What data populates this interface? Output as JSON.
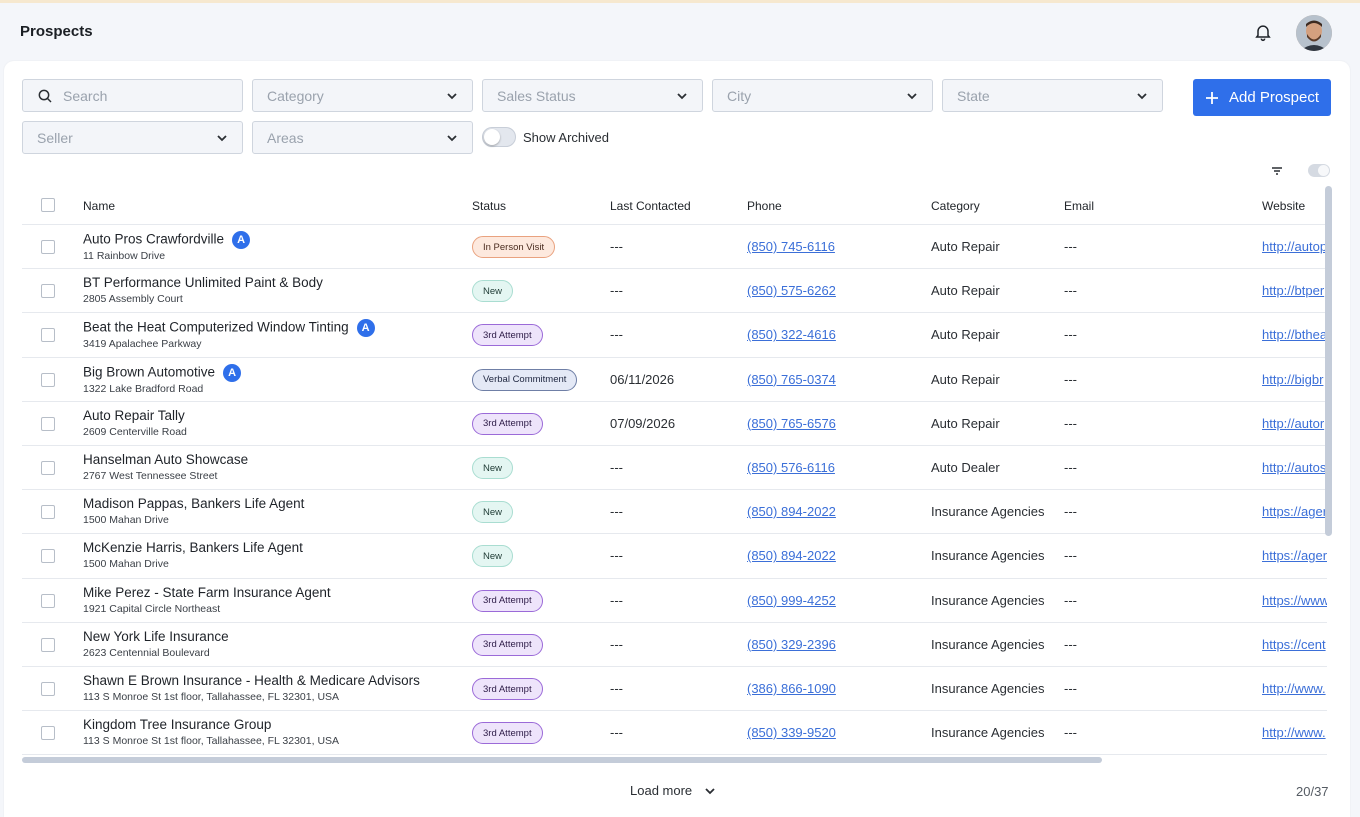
{
  "header": {
    "title": "Prospects"
  },
  "filters": {
    "search_placeholder": "Search",
    "category": "Category",
    "sales_status": "Sales Status",
    "city": "City",
    "state": "State",
    "seller": "Seller",
    "areas": "Areas",
    "show_archived": "Show Archived"
  },
  "add_button": "Add Prospect",
  "columns": [
    "Name",
    "Status",
    "Last Contacted",
    "Phone",
    "Category",
    "Email",
    "Website"
  ],
  "rows": [
    {
      "name": "Auto Pros Crawfordville",
      "badge": "A",
      "address": "11 Rainbow Drive",
      "status": "In Person Visit",
      "status_kind": "visit",
      "last": "---",
      "phone": "(850) 745-6116",
      "category": "Auto Repair",
      "email": "---",
      "website": "http://autop"
    },
    {
      "name": "BT Performance Unlimited Paint & Body",
      "badge": "",
      "address": "2805 Assembly Court",
      "status": "New",
      "status_kind": "new",
      "last": "---",
      "phone": "(850) 575-6262",
      "category": "Auto Repair",
      "email": "---",
      "website": "http://btper"
    },
    {
      "name": "Beat the Heat Computerized Window Tinting",
      "badge": "A",
      "address": "3419 Apalachee Parkway",
      "status": "3rd Attempt",
      "status_kind": "attempt",
      "last": "---",
      "phone": "(850) 322-4616",
      "category": "Auto Repair",
      "email": "---",
      "website": "http://bthea"
    },
    {
      "name": "Big Brown Automotive",
      "badge": "A",
      "address": "1322 Lake Bradford Road",
      "status": "Verbal Commitment",
      "status_kind": "verbal",
      "last": "06/11/2026",
      "phone": "(850) 765-0374",
      "category": "Auto Repair",
      "email": "---",
      "website": "http://bigbr"
    },
    {
      "name": "Auto Repair Tally",
      "badge": "",
      "address": "2609 Centerville Road",
      "status": "3rd Attempt",
      "status_kind": "attempt",
      "last": "07/09/2026",
      "phone": "(850) 765-6576",
      "category": "Auto Repair",
      "email": "---",
      "website": "http://autor"
    },
    {
      "name": "Hanselman Auto Showcase",
      "badge": "",
      "address": "2767 West Tennessee Street",
      "status": "New",
      "status_kind": "new",
      "last": "---",
      "phone": "(850) 576-6116",
      "category": "Auto Dealer",
      "email": "---",
      "website": "http://autos"
    },
    {
      "name": "Madison Pappas, Bankers Life Agent",
      "badge": "",
      "address": "1500 Mahan Drive",
      "status": "New",
      "status_kind": "new",
      "last": "---",
      "phone": "(850) 894-2022",
      "category": "Insurance Agencies",
      "email": "---",
      "website": "https://ager"
    },
    {
      "name": "McKenzie Harris, Bankers Life Agent",
      "badge": "",
      "address": "1500 Mahan Drive",
      "status": "New",
      "status_kind": "new",
      "last": "---",
      "phone": "(850) 894-2022",
      "category": "Insurance Agencies",
      "email": "---",
      "website": "https://ager"
    },
    {
      "name": "Mike Perez - State Farm Insurance Agent",
      "badge": "",
      "address": "1921 Capital Circle Northeast",
      "status": "3rd Attempt",
      "status_kind": "attempt",
      "last": "---",
      "phone": "(850) 999-4252",
      "category": "Insurance Agencies",
      "email": "---",
      "website": "https://www"
    },
    {
      "name": "New York Life Insurance",
      "badge": "",
      "address": "2623 Centennial Boulevard",
      "status": "3rd Attempt",
      "status_kind": "attempt",
      "last": "---",
      "phone": "(850) 329-2396",
      "category": "Insurance Agencies",
      "email": "---",
      "website": "https://cent"
    },
    {
      "name": "Shawn E Brown Insurance - Health & Medicare Advisors",
      "badge": "",
      "address": "113 S Monroe St 1st floor, Tallahassee, FL 32301, USA",
      "status": "3rd Attempt",
      "status_kind": "attempt",
      "last": "---",
      "phone": "(386) 866-1090",
      "category": "Insurance Agencies",
      "email": "---",
      "website": "http://www."
    },
    {
      "name": "Kingdom Tree Insurance Group",
      "badge": "",
      "address": "113 S Monroe St 1st floor, Tallahassee, FL 32301, USA",
      "status": "3rd Attempt",
      "status_kind": "attempt",
      "last": "---",
      "phone": "(850) 339-9520",
      "category": "Insurance Agencies",
      "email": "---",
      "website": "http://www."
    }
  ],
  "footer": {
    "load_more": "Load more",
    "counter": "20/37"
  },
  "colors": {
    "accent": "#2f6fea",
    "link": "#3b6fd8"
  }
}
